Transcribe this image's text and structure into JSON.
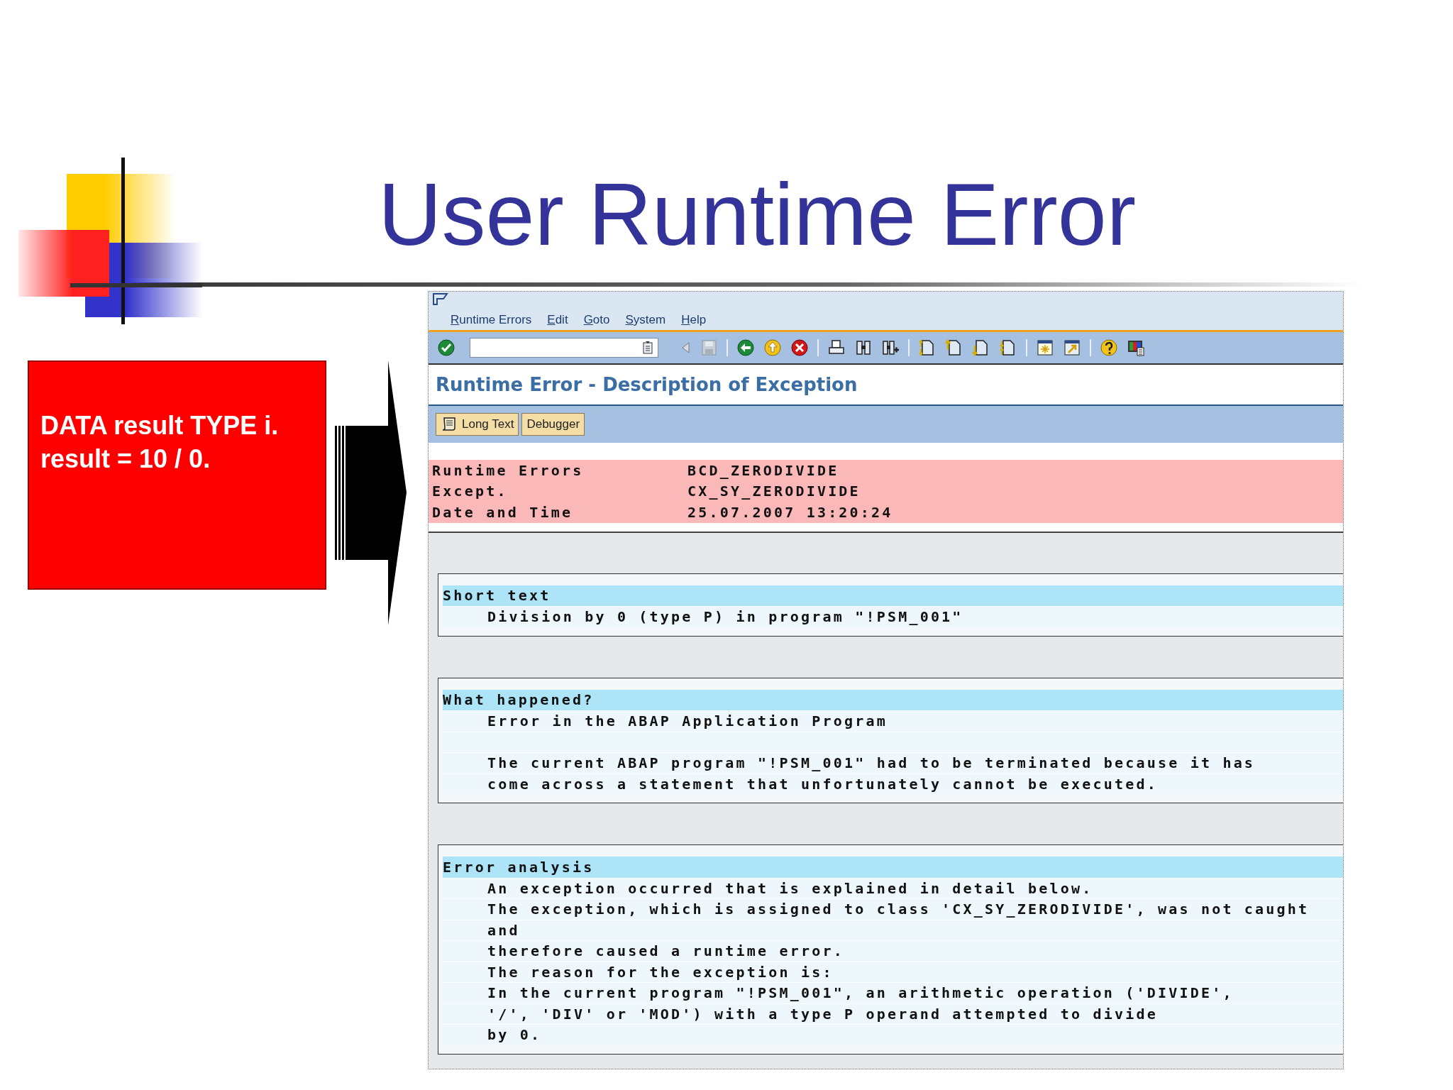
{
  "slide": {
    "title": "User Runtime Error",
    "code_box": {
      "lines": [
        "DATA result TYPE i.",
        "result = 10 / 0."
      ]
    }
  },
  "sap_window": {
    "menu": [
      "Runtime Errors",
      "Edit",
      "Goto",
      "System",
      "Help"
    ],
    "screen_title": "Runtime Error - Description of Exception",
    "buttons": [
      {
        "label": "Long Text",
        "kind": "icon"
      },
      {
        "label": "Debugger",
        "kind": "plain"
      }
    ],
    "header_fields": [
      {
        "label": "Runtime Errors",
        "value": "BCD_ZERODIVIDE"
      },
      {
        "label": "Except.",
        "value": "CX_SY_ZERODIVIDE"
      },
      {
        "label": "Date and Time",
        "value": "25.07.2007 13:20:24"
      }
    ],
    "sections": [
      {
        "title": "Short text",
        "paragraphs": [
          [
            "Division by 0 (type P) in program \"!PSM_001\""
          ]
        ]
      },
      {
        "title": "What happened?",
        "paragraphs": [
          [
            "Error in the ABAP Application Program"
          ],
          [
            "The current ABAP program \"!PSM_001\" had to be terminated because it has",
            "come across a statement that unfortunately cannot be executed."
          ]
        ]
      },
      {
        "title": "Error analysis",
        "paragraphs": [
          [
            "An exception occurred that is explained in detail below.",
            "The exception, which is assigned to class 'CX_SY_ZERODIVIDE', was not caught",
            "and",
            "therefore caused a runtime error.",
            "The reason for the exception is:",
            "In the current program \"!PSM_001\", an arithmetic operation ('DIVIDE',",
            "'/', 'DIV' or 'MOD') with a type P operand attempted to divide",
            "by 0."
          ]
        ]
      }
    ]
  }
}
